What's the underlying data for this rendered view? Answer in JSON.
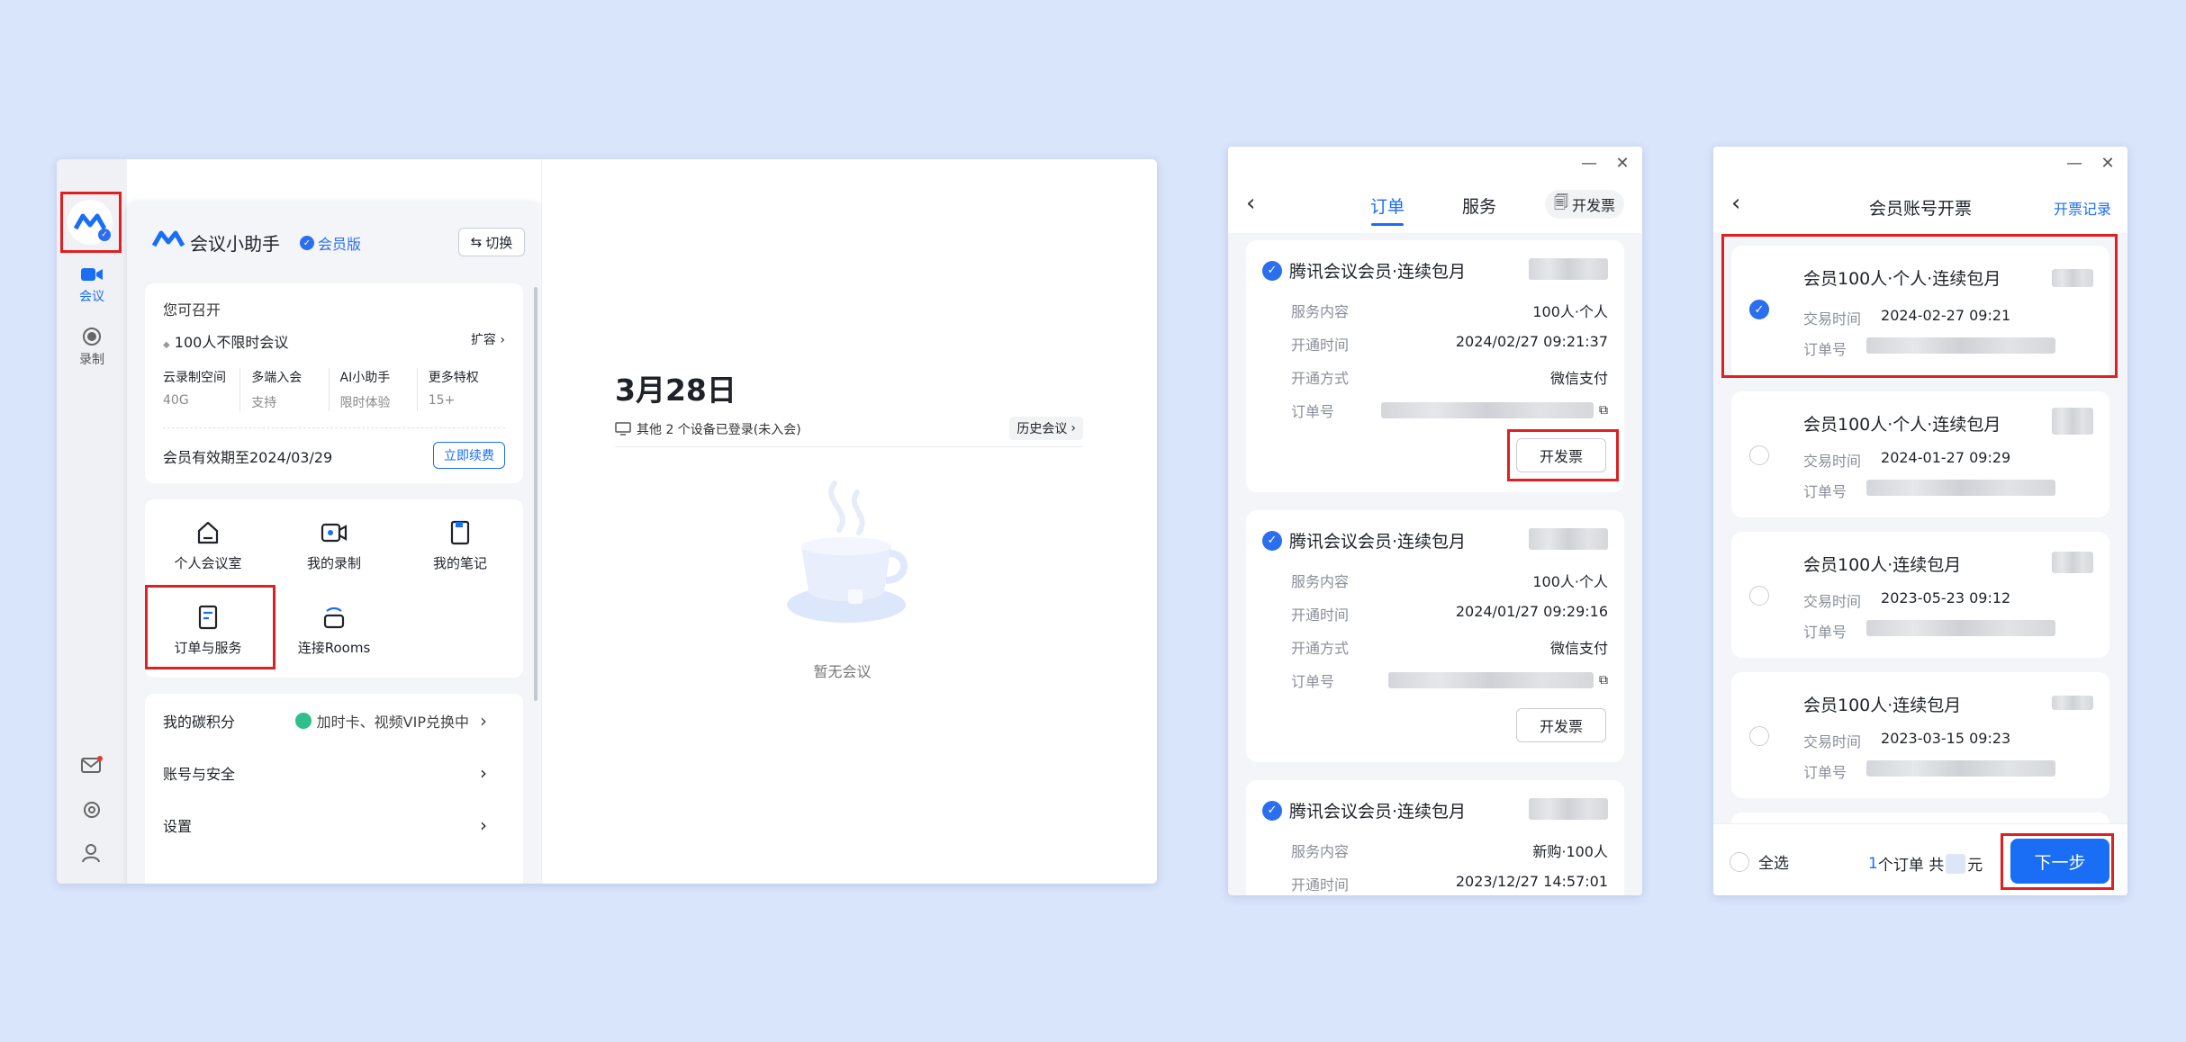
{
  "colors": {
    "accent": "#1a6df5",
    "highlight": "#e02020",
    "background": "#d9e5fb"
  },
  "meeting_window": {
    "sidebar": {
      "items": [
        {
          "label": "会议",
          "icon": "video-camera-icon"
        },
        {
          "label": "录制",
          "icon": "record-icon"
        }
      ]
    },
    "panel": {
      "app_name": "会议小助手",
      "badge": "会员版",
      "switch_label": "切换",
      "available_title": "您可召开",
      "meeting_type": "100人不限时会议",
      "expand_label": "扩容",
      "stats": [
        {
          "label": "云录制空间",
          "value": "40G"
        },
        {
          "label": "多端入会",
          "value": "支持"
        },
        {
          "label": "AI小助手",
          "value": "限时体验"
        },
        {
          "label": "更多特权",
          "value": "15+"
        }
      ],
      "validity": "会员有效期至2024/03/29",
      "renew_label": "立即续费",
      "features": [
        {
          "label": "个人会议室",
          "icon": "home-icon"
        },
        {
          "label": "我的录制",
          "icon": "video-camera-icon"
        },
        {
          "label": "我的笔记",
          "icon": "note-icon"
        },
        {
          "label": "订单与服务",
          "icon": "order-icon"
        },
        {
          "label": "连接Rooms",
          "icon": "rooms-icon"
        }
      ],
      "carbon_label": "我的碳积分",
      "carbon_hint": "加时卡、视频VIP兑换中",
      "account_label": "账号与安全",
      "settings_label": "设置"
    },
    "main": {
      "date": "3月28日",
      "devices_note": "其他 2 个设备已登录(未入会)",
      "history_label": "历史会议",
      "empty_text": "暂无会议"
    }
  },
  "orders_window": {
    "tabs": [
      "订单",
      "服务"
    ],
    "invoice_label": "开发票",
    "field_labels": {
      "service": "服务内容",
      "open_time": "开通时间",
      "method": "开通方式",
      "order_no": "订单号"
    },
    "orders": [
      {
        "title": "腾讯会议会员·连续包月",
        "service": "100人·个人",
        "open_time": "2024/02/27 09:21:37",
        "method": "微信支付",
        "button": "开发票"
      },
      {
        "title": "腾讯会议会员·连续包月",
        "service": "100人·个人",
        "open_time": "2024/01/27 09:29:16",
        "method": "微信支付",
        "button": "开发票"
      },
      {
        "title": "腾讯会议会员·连续包月",
        "service": "新购·100人",
        "open_time": "2023/12/27 14:57:01"
      }
    ]
  },
  "invoice_window": {
    "title": "会员账号开票",
    "records_label": "开票记录",
    "field_labels": {
      "time": "交易时间",
      "order_no": "订单号"
    },
    "items": [
      {
        "title": "会员100人·个人·连续包月",
        "time": "2024-02-27 09:21",
        "selected": true
      },
      {
        "title": "会员100人·个人·连续包月",
        "time": "2024-01-27 09:29",
        "selected": false
      },
      {
        "title": "会员100人·连续包月",
        "time": "2023-05-23 09:12",
        "selected": false
      },
      {
        "title": "会员100人·连续包月",
        "time": "2023-03-15 09:23",
        "selected": false
      }
    ],
    "footer": {
      "select_all": "全选",
      "count": "1",
      "count_suffix": "个订单 共",
      "currency": "元",
      "next": "下一步"
    }
  }
}
